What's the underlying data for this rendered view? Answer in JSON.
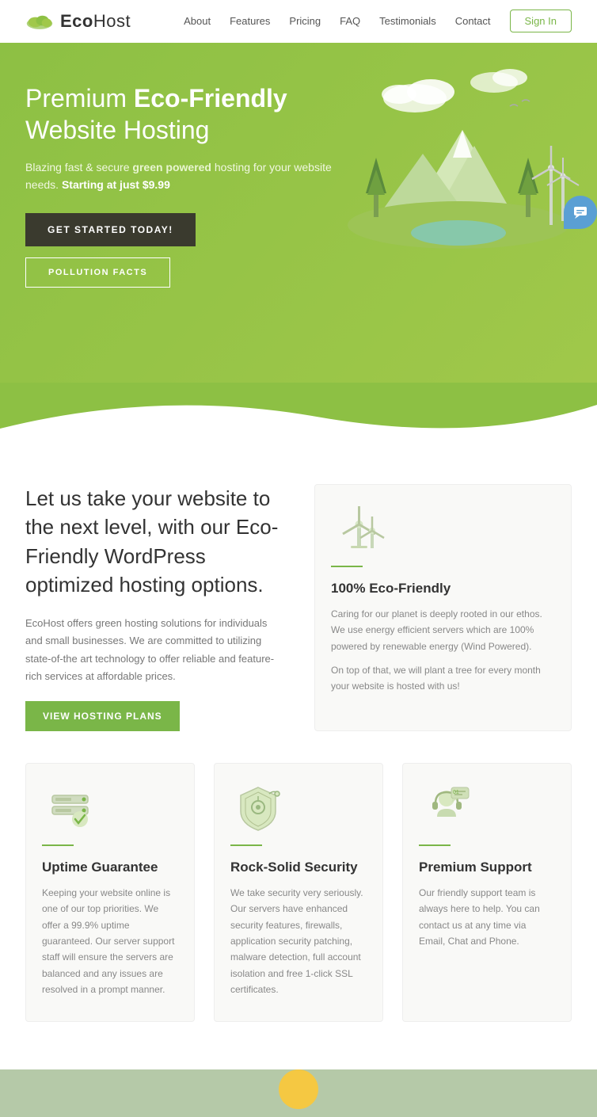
{
  "nav": {
    "logo_text_regular": "Eco",
    "logo_text_bold": "Host",
    "links": [
      "About",
      "Features",
      "Pricing",
      "FAQ",
      "Testimonials",
      "Contact"
    ],
    "signin_label": "Sign In"
  },
  "hero": {
    "heading_regular": "Premium ",
    "heading_bold": "Eco-Friendly",
    "heading_line2": "Website Hosting",
    "subtext_regular": "Blazing fast & secure ",
    "subtext_green": "green powered",
    "subtext_middle": " hosting for your website needs. ",
    "subtext_bold": "Starting at just $9.99",
    "btn_primary": "GET STARTED TODAY!",
    "btn_secondary": "POLLUTION FACTS"
  },
  "section_intro": {
    "heading": "Let us take your website to the next level, with our Eco-Friendly WordPress optimized hosting options.",
    "body": "EcoHost offers green hosting solutions for individuals and small businesses. We are committed to utilizing state-of-the art technology to offer reliable and feature-rich services at affordable prices.",
    "btn_label": "VIEW HOSTING PLANS"
  },
  "features": [
    {
      "id": "eco-friendly",
      "title": "100% Eco-Friendly",
      "description1": "Caring for our planet is deeply rooted in our ethos. We use energy efficient servers which are 100% powered by renewable energy (Wind Powered).",
      "description2": "On top of that, we will plant a tree for every month your website is hosted with us!",
      "icon": "windmill"
    },
    {
      "id": "uptime",
      "title": "Uptime Guarantee",
      "description1": "Keeping your website online is one of our top priorities. We offer a 99.9% uptime guaranteed. Our server support staff will ensure the servers are balanced and any issues are resolved in a prompt manner.",
      "description2": "",
      "icon": "server"
    },
    {
      "id": "security",
      "title": "Rock-Solid Security",
      "description1": "We take security very seriously. Our servers have enhanced security features, firewalls, application security patching, malware detection, full account isolation and free 1-click SSL certificates.",
      "description2": "",
      "icon": "shield"
    },
    {
      "id": "support",
      "title": "Premium Support",
      "description1": "Our friendly support team is always here to help. You can contact us at any time via Email, Chat and Phone.",
      "description2": "",
      "icon": "headset"
    }
  ],
  "chat": {
    "icon": "chat-icon"
  }
}
